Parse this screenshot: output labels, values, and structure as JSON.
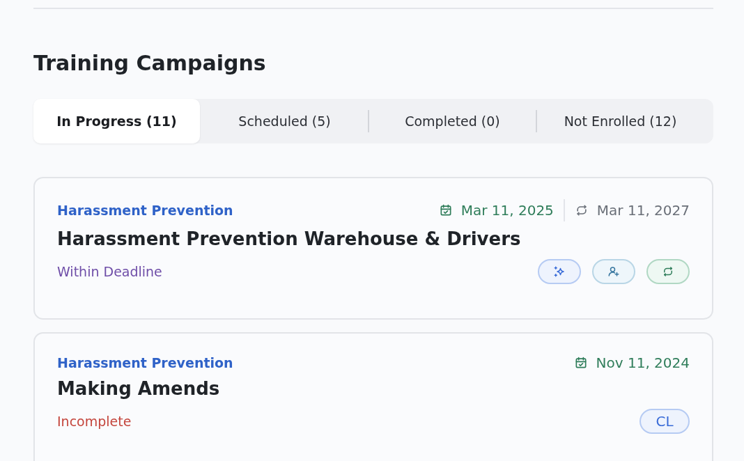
{
  "title": "Training Campaigns",
  "tabs": [
    {
      "label": "In Progress (11)",
      "selected": true
    },
    {
      "label": "Scheduled (5)",
      "selected": false
    },
    {
      "label": "Completed (0)",
      "selected": false
    },
    {
      "label": "Not Enrolled (12)",
      "selected": false
    }
  ],
  "campaigns": [
    {
      "category": "Harassment Prevention",
      "start_date": "Mar 11, 2025",
      "renewal_date": "Mar 11, 2027",
      "name": "Harassment Prevention Warehouse & Drivers",
      "status": {
        "text": "Within Deadline",
        "color": "#6f4ea8"
      },
      "badges": [
        {
          "kind": "sparkle"
        },
        {
          "kind": "user-add"
        },
        {
          "kind": "repeat"
        }
      ]
    },
    {
      "category": "Harassment Prevention",
      "start_date": "Nov 11, 2024",
      "name": "Making Amends",
      "status": {
        "text": "Incomplete",
        "color": "#c4453c"
      },
      "badges": [
        {
          "kind": "text",
          "label": "CL"
        }
      ]
    }
  ]
}
